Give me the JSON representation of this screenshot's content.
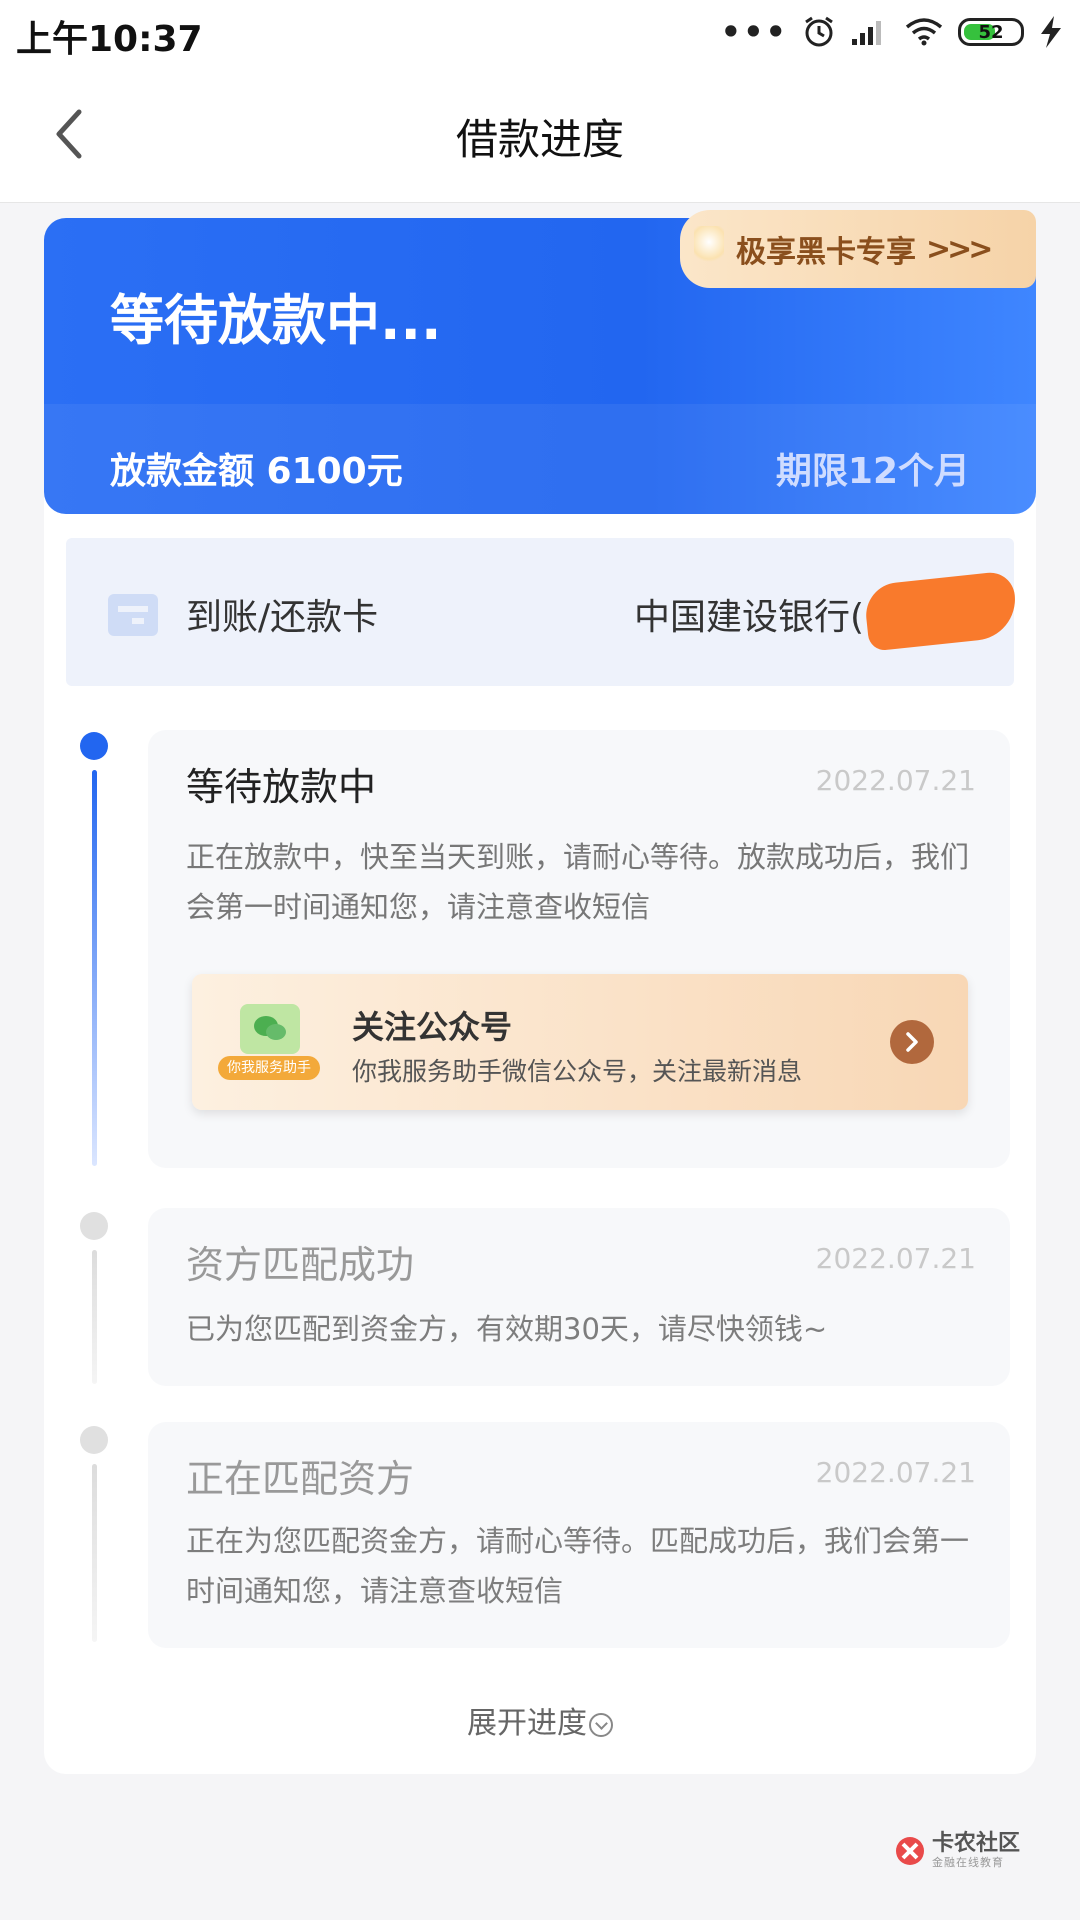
{
  "status_bar": {
    "time": "上午10:37",
    "battery": "52"
  },
  "nav": {
    "title": "借款进度"
  },
  "hero": {
    "status": "等待放款中...",
    "amount": "放款金额 6100元",
    "term": "期限12个月",
    "vip_badge": "极享黑卡专享",
    "vip_arrows": ">>>"
  },
  "account_card": {
    "label": "到账/还款卡",
    "bank": "中国建设银行("
  },
  "timeline": [
    {
      "title": "等待放款中",
      "date": "2022.07.21",
      "desc": "正在放款中，快至当天到账，请耐心等待。放款成功后，我们会第一时间通知您，请注意查收短信"
    },
    {
      "title": "资方匹配成功",
      "date": "2022.07.21",
      "desc": "已为您匹配到资金方，有效期30天，请尽快领钱~"
    },
    {
      "title": "正在匹配资方",
      "date": "2022.07.21",
      "desc": "正在为您匹配资金方，请耐心等待。匹配成功后，我们会第一时间通知您，请注意查收短信"
    }
  ],
  "promo": {
    "title": "关注公众号",
    "subtitle": "你我服务助手微信公众号，关注最新消息",
    "image_tag": "你我服务助手"
  },
  "expand_label": "展开进度",
  "watermark": {
    "title": "卡农社区",
    "subtitle": "金融在线教育"
  },
  "colors": {
    "primary": "#2266f0",
    "vip_text": "#8a4f1d",
    "promo_arrow": "#b1683d",
    "redaction": "#f97a2c"
  },
  "icons": [
    "back-arrow-icon",
    "card-icon",
    "chevron-right-icon",
    "chevron-down-circle-icon",
    "wechat-icon",
    "alarm-icon",
    "signal-icon",
    "wifi-icon",
    "battery-icon",
    "charging-icon"
  ]
}
